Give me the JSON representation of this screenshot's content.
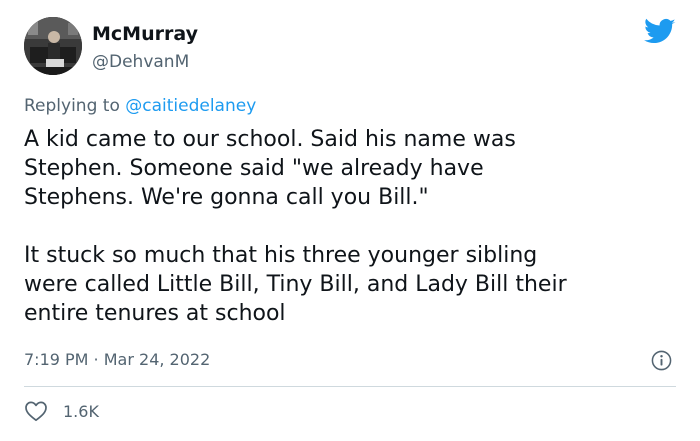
{
  "user": {
    "name": "McMurray",
    "handle": "@DehvanM",
    "avatar_icon": "profile-photo"
  },
  "reply": {
    "prefix": "Replying to ",
    "mention": "@caitiedelaney"
  },
  "tweet": {
    "paragraph1": [
      "A kid came to our school. Said his name was",
      "Stephen. Someone said \"we already have",
      "Stephens. We're gonna call you Bill.\""
    ],
    "paragraph2": [
      "It stuck so much that his three younger sibling",
      "were called Little Bill, Tiny Bill, and Lady Bill their",
      "entire tenures at school"
    ]
  },
  "meta": {
    "time": "7:19 PM",
    "separator": " · ",
    "date": "Mar 24, 2022"
  },
  "stats": {
    "likes": "1.6K"
  },
  "icons": {
    "brand": "twitter-bird-icon",
    "info": "info-icon",
    "like": "heart-icon"
  },
  "colors": {
    "brand": "#1d9bf0",
    "text": "#0f1419",
    "secondary": "#536471",
    "divider": "#cfd9de"
  }
}
